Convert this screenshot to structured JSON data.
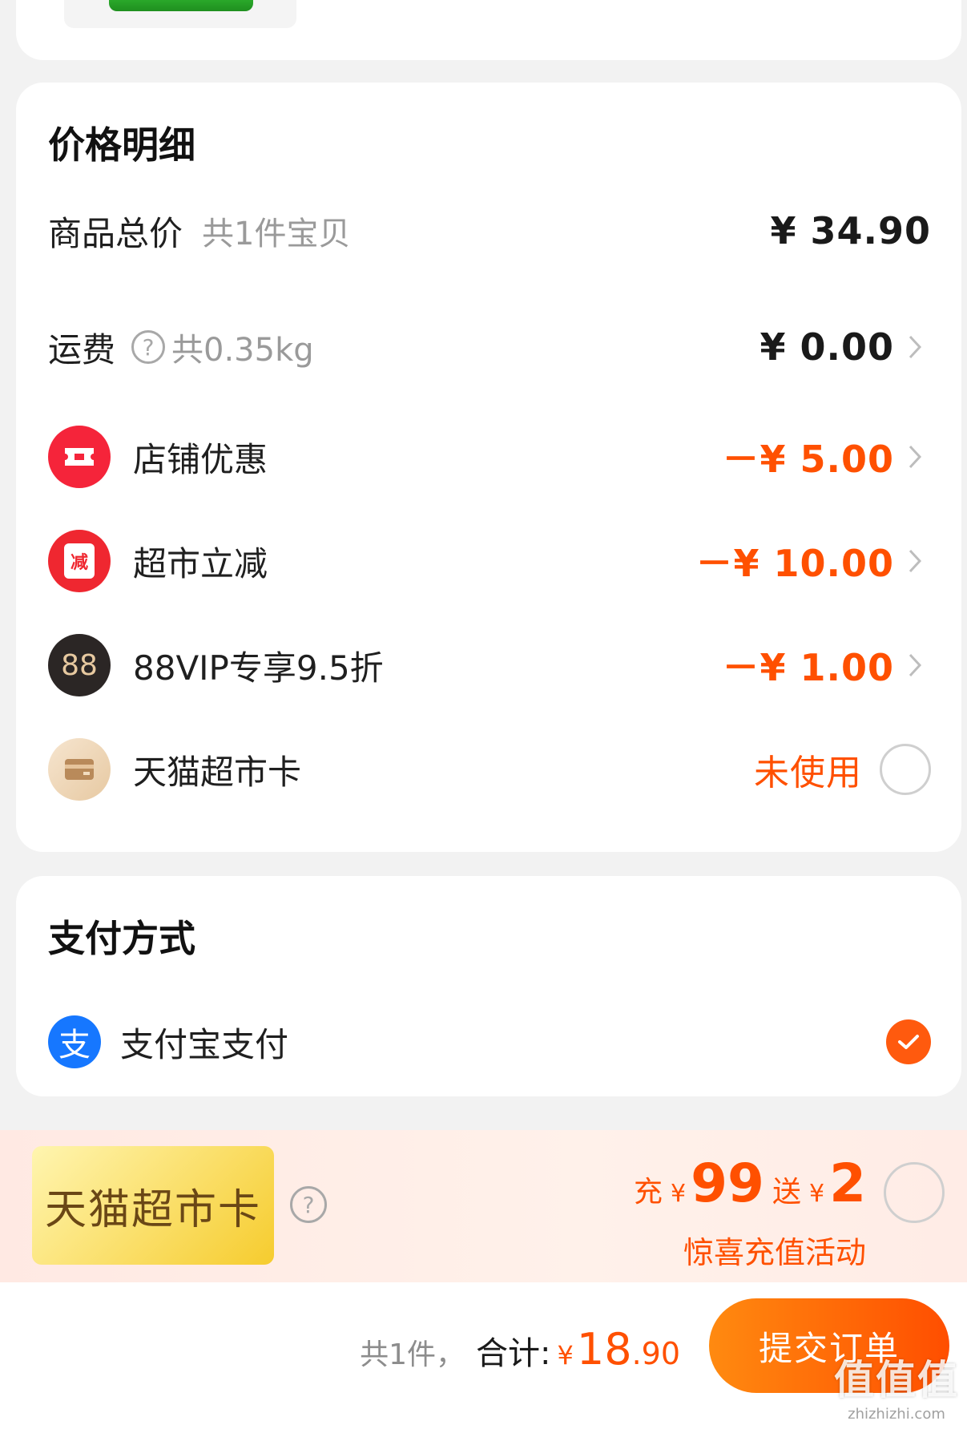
{
  "price_details": {
    "title": "价格明细",
    "goods_total": {
      "label": "商品总价",
      "sub": "共1件宝贝",
      "amount": "¥ 34.90"
    },
    "shipping": {
      "label": "运费",
      "help": "?",
      "sub": "共0.35kg",
      "amount": "¥ 0.00"
    },
    "discounts": [
      {
        "label": "店铺优惠",
        "amount": "－¥ 5.00",
        "icon": "ticket-icon",
        "color": "#f5243a"
      },
      {
        "label": "超市立减",
        "amount": "－¥ 10.00",
        "icon": "reduce-icon",
        "icon_text": "减",
        "color": "#ef2730"
      },
      {
        "label": "88VIP专享9.5折",
        "amount": "－¥ 1.00",
        "icon": "vip88-icon",
        "icon_text": "88",
        "color": "#2b2625"
      }
    ],
    "card": {
      "label": "天猫超市卡",
      "status": "未使用",
      "icon": "card-icon"
    }
  },
  "payment": {
    "title": "支付方式",
    "method": {
      "label": "支付宝支付",
      "icon_text": "支",
      "icon": "alipay-icon",
      "selected": true
    }
  },
  "promo": {
    "badge": "天猫超市卡",
    "help": "?",
    "recharge_label": "充",
    "recharge_yen": "¥",
    "recharge_amount": "99",
    "gift_label": "送",
    "gift_yen": "¥",
    "gift_amount": "2",
    "subtitle": "惊喜充值活动"
  },
  "footer": {
    "count": "共1件，",
    "total_label": "合计:",
    "yen": "¥",
    "total_int": "18",
    "total_dec": ".90",
    "submit": "提交订单"
  },
  "watermark": {
    "main": "值值值",
    "site": "zhizhizhi.com"
  },
  "colors": {
    "accent": "#ff5000",
    "alipay": "#1677ff"
  }
}
